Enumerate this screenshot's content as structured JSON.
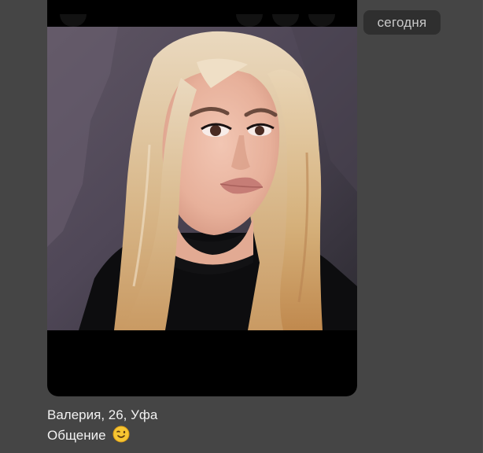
{
  "date_chip": {
    "label": "сегодня"
  },
  "message": {
    "caption_line1": "Валерия, 26, Уфа",
    "caption_line2": "Общение",
    "emoji_icon": "winking-face-icon"
  },
  "colors": {
    "background": "#454545",
    "chip_background": "#2f2f2f",
    "chip_text": "#c9c9c9",
    "caption_text": "#f2f2f2",
    "media_frame": "#000000"
  }
}
